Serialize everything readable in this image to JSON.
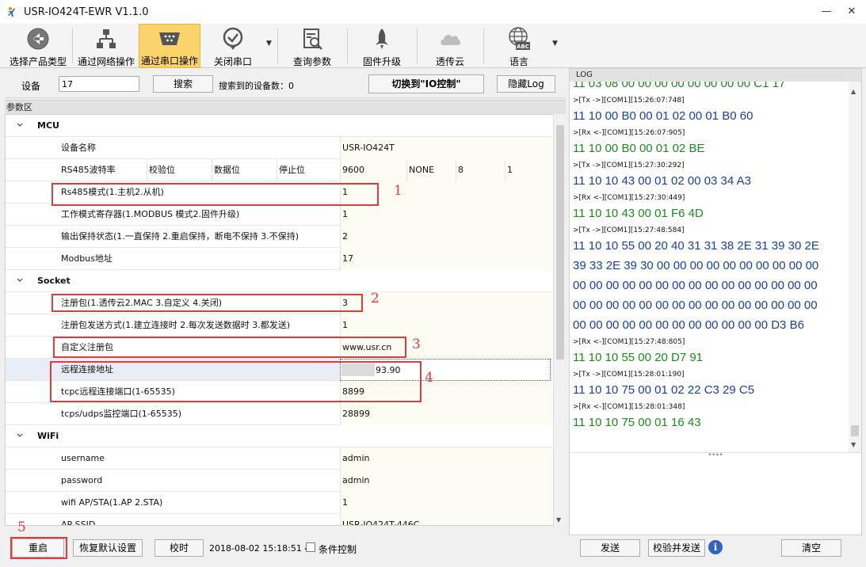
{
  "window": {
    "title": "USR-IO424T-EWR V1.1.0"
  },
  "toolbar": {
    "items": [
      {
        "label": "选择产品类型",
        "icon": "back-arrow-icon"
      },
      {
        "label": "通过网络操作",
        "icon": "network-icon"
      },
      {
        "label": "通过串口操作",
        "icon": "serial-port-icon",
        "active": true
      },
      {
        "label": "关闭串口",
        "icon": "check-circle-icon"
      },
      {
        "label": "查询参数",
        "icon": "search-document-icon"
      },
      {
        "label": "固件升级",
        "icon": "rocket-icon"
      },
      {
        "label": "透传云",
        "icon": "cloud-icon"
      },
      {
        "label": "语言",
        "icon": "globe-abc-icon"
      }
    ]
  },
  "device": {
    "label": "设备",
    "value": "17",
    "search_button": "搜索",
    "found_text": "搜索到的设备数：0",
    "switch_button": "切换到\"IO控制\"",
    "hide_log_button": "隐藏Log"
  },
  "params": {
    "header": "参数区",
    "sections": {
      "mcu": "MCU",
      "socket": "Socket",
      "wifi": "WiFi"
    },
    "rows": {
      "device_name": {
        "label": "设备名称",
        "value": "USR-IO424T"
      },
      "rs485": {
        "label": "RS485波特率",
        "parity_label": "校验位",
        "databits_label": "数据位",
        "stopbits_label": "停止位",
        "baud": "9600",
        "parity": "NONE",
        "databits": "8",
        "stopbits": "1"
      },
      "rs485_mode": {
        "label": "Rs485模式(1.主机2.从机)",
        "value": "1"
      },
      "work_mode": {
        "label": "工作模式寄存器(1.MODBUS 模式2.固件升级)",
        "value": "1"
      },
      "output_keep": {
        "label": "输出保持状态(1.一直保持 2.重启保持，断电不保持 3.不保持)",
        "value": "2"
      },
      "modbus_addr": {
        "label": "Modbus地址",
        "value": "17"
      },
      "reg_pkg": {
        "label": "注册包(1.透传云2.MAC 3.自定义 4.关闭)",
        "value": "3"
      },
      "reg_send": {
        "label": "注册包发送方式(1.建立连接时 2.每次发送数据时 3.都发送)",
        "value": "1"
      },
      "custom_reg": {
        "label": "自定义注册包",
        "value": "www.usr.cn"
      },
      "remote_addr": {
        "label": "远程连接地址",
        "value": "93.90"
      },
      "tcpc_port": {
        "label": "tcpc远程连接端口(1-65535)",
        "value": "8899"
      },
      "tcps_port": {
        "label": "tcps/udps监控端口(1-65535)",
        "value": "28899"
      },
      "username": {
        "label": "username",
        "value": "admin"
      },
      "password": {
        "label": "password",
        "value": "admin"
      },
      "wifi_mode": {
        "label": "wifi AP/STA(1.AP 2.STA)",
        "value": "1"
      },
      "ap_ssid": {
        "label": "AP SSID",
        "value": "USR-IO424T-446C"
      }
    },
    "annotations": [
      "1",
      "2",
      "3",
      "4",
      "5"
    ]
  },
  "bottom": {
    "restart": "重启",
    "restore": "恢复默认设置",
    "timesync": "校时",
    "datetime": "2018-08-02 15:18:51 4",
    "condition": "条件控制"
  },
  "log": {
    "header": "LOG",
    "lines": [
      {
        "kind": "rx",
        "text": "11 03 08 00 00 00 00 00 00 00 00 C1 17"
      },
      {
        "kind": "meta",
        "text": ">[Tx ->][COM1][15:26:07:748]"
      },
      {
        "kind": "tx",
        "text": "11 10 00 B0 00 01 02 00 01 B0 60"
      },
      {
        "kind": "meta",
        "text": ">[Rx <-][COM1][15:26:07:905]"
      },
      {
        "kind": "rx",
        "text": "11 10 00 B0 00 01 02 BE"
      },
      {
        "kind": "meta",
        "text": ">[Tx ->][COM1][15:27:30:292]"
      },
      {
        "kind": "tx",
        "text": "11 10 10 43 00 01 02 00 03 34 A3"
      },
      {
        "kind": "meta",
        "text": ">[Rx <-][COM1][15:27:30:449]"
      },
      {
        "kind": "rx",
        "text": "11 10 10 43 00 01 F6 4D"
      },
      {
        "kind": "meta",
        "text": ">[Tx ->][COM1][15:27:48:584]"
      },
      {
        "kind": "tx",
        "text": "11 10 10 55 00 20 40 31 31 38 2E 31 39 30 2E"
      },
      {
        "kind": "tx",
        "text": "39 33 2E 39 30 00 00 00 00 00 00 00 00 00 00"
      },
      {
        "kind": "tx",
        "text": "00 00 00 00 00 00 00 00 00 00 00 00 00 00 00"
      },
      {
        "kind": "tx",
        "text": "00 00 00 00 00 00 00 00 00 00 00 00 00 00 00"
      },
      {
        "kind": "tx",
        "text": "00 00 00 00 00 00 00 00 00 00 00 00 D3 B6"
      },
      {
        "kind": "meta",
        "text": ">[Rx <-][COM1][15:27:48:805]"
      },
      {
        "kind": "rx",
        "text": "11 10 10 55 00 20 D7 91"
      },
      {
        "kind": "meta",
        "text": ">[Tx ->][COM1][15:28:01:190]"
      },
      {
        "kind": "tx",
        "text": "11 10 10 75 00 01 02 22 C3 29 C5"
      },
      {
        "kind": "meta",
        "text": ">[Rx <-][COM1][15:28:01:348]"
      },
      {
        "kind": "rx",
        "text": "11 10 10 75 00 01 16 43"
      }
    ],
    "send": "发送",
    "verify_send": "校验并发送",
    "clear": "清空"
  }
}
